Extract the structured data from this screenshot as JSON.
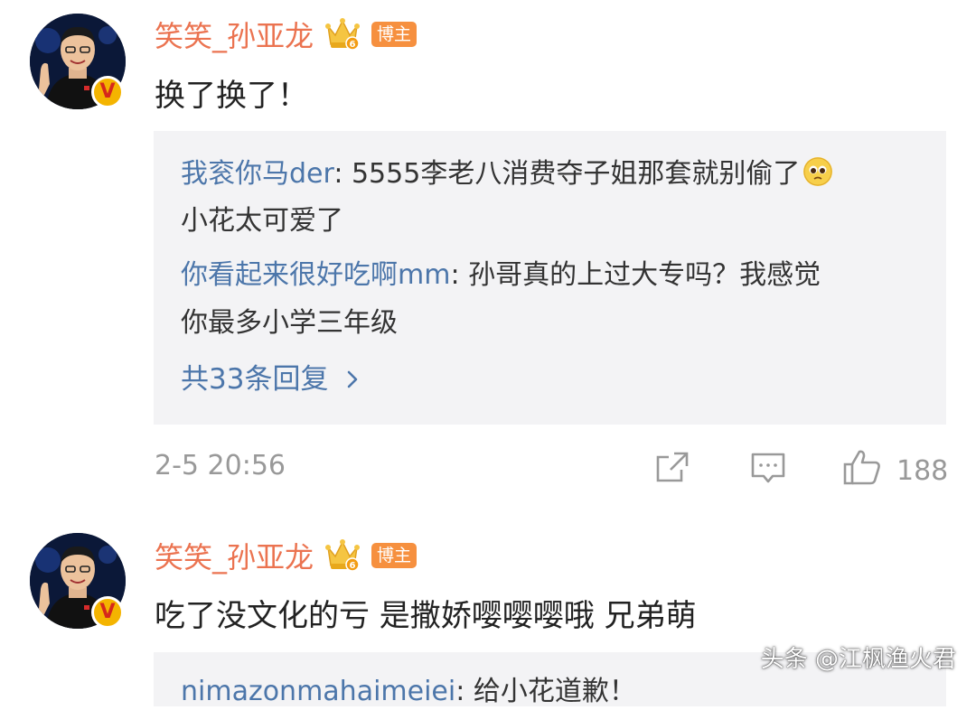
{
  "comments": [
    {
      "username": "笑笑_孙亚龙",
      "crown_level": "6",
      "host_badge": "博主",
      "verified_badge": "V",
      "content": "换了换了！",
      "replies": [
        {
          "user": "我衮你马der",
          "separator": ": ",
          "text_line1": "5555李老八消费夺子姐那套就别偷了",
          "emoji": "pleading-face-emoji",
          "text_line2": "小花太可爱了"
        },
        {
          "user": "你看起来很好吃啊mm",
          "separator": ": ",
          "text_line1": "孙哥真的上过大专吗？我感觉",
          "text_line2": "你最多小学三年级"
        }
      ],
      "more_replies": "共33条回复",
      "timestamp": "2-5 20:56",
      "likes": "188"
    },
    {
      "username": "笑笑_孙亚龙",
      "crown_level": "6",
      "host_badge": "博主",
      "verified_badge": "V",
      "content": "吃了没文化的亏 是撒娇嘤嘤嘤哦 兄弟萌",
      "replies": [
        {
          "user": "nimazonmahaimeiei",
          "separator": ": ",
          "text_line1": "给小花道歉！"
        }
      ]
    }
  ],
  "watermark": "头条 @江枫渔火君",
  "colors": {
    "username": "#eb7350",
    "reply_user": "#4c76aa",
    "host_badge_bg": "#f6903f",
    "reply_bg": "#f3f3f5",
    "meta_gray": "#999999"
  },
  "icons": [
    "repost-icon",
    "comment-icon",
    "like-icon",
    "crown-icon",
    "verified-icon"
  ]
}
